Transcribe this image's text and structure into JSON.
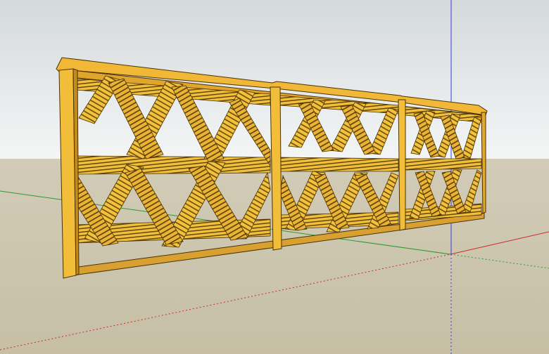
{
  "app": {
    "title": ""
  },
  "scene": {
    "description_free": true,
    "colors": {
      "sky_top": "#d4d9da",
      "sky_bottom": "#f4f6f6",
      "ground_top": "#d2ccb7",
      "ground_bottom": "#c6bfa6",
      "wood_light": "#f4c43a",
      "wood_mid": "#e6a92b",
      "wood_dark": "#b37812",
      "wood_edge": "#4a3205",
      "red_axis": "#cc2a2a",
      "green_axis": "#2f9b2f",
      "blue_axis": "#3b3bd8"
    },
    "icons": [
      "red-axis-icon",
      "green-axis-icon",
      "blue-axis-icon"
    ]
  }
}
